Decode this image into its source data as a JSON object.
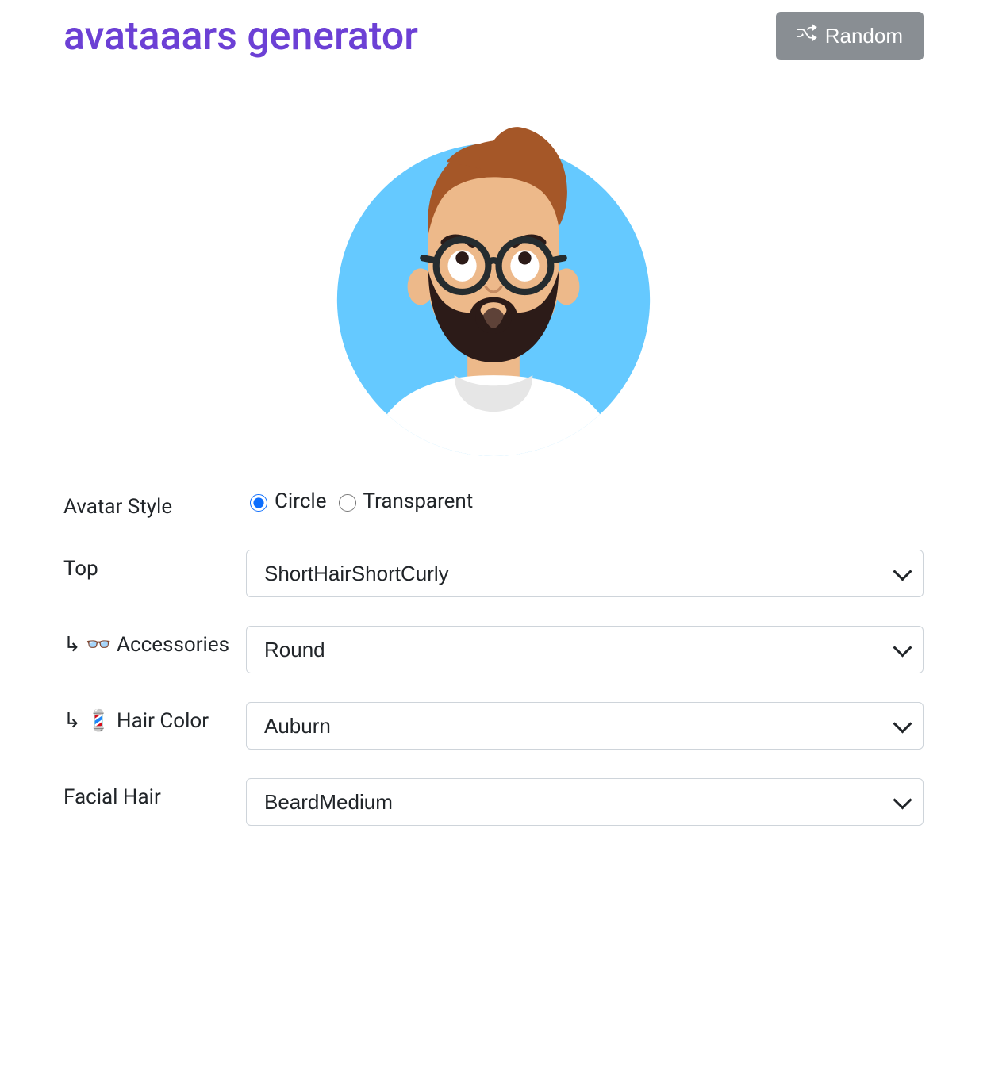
{
  "header": {
    "title": "avataaars generator",
    "random_label": "Random"
  },
  "form": {
    "avatar_style": {
      "label": "Avatar Style",
      "options": {
        "circle": "Circle",
        "transparent": "Transparent"
      },
      "selected": "circle"
    },
    "top": {
      "label": "Top",
      "value": "ShortHairShortCurly"
    },
    "accessories": {
      "label": "↳ 👓 Accessories",
      "value": "Round"
    },
    "hair_color": {
      "label": "↳ 💈 Hair Color",
      "value": "Auburn"
    },
    "facial_hair": {
      "label": "Facial Hair",
      "value": "BeardMedium"
    }
  },
  "avatar": {
    "background_color": "#65C9FF",
    "hair_color": "#A55728",
    "beard_color": "#2C1B18",
    "skin_color": "#EDB98A",
    "glasses_color": "#252C2F",
    "shirt_color": "#FFFFFF"
  }
}
